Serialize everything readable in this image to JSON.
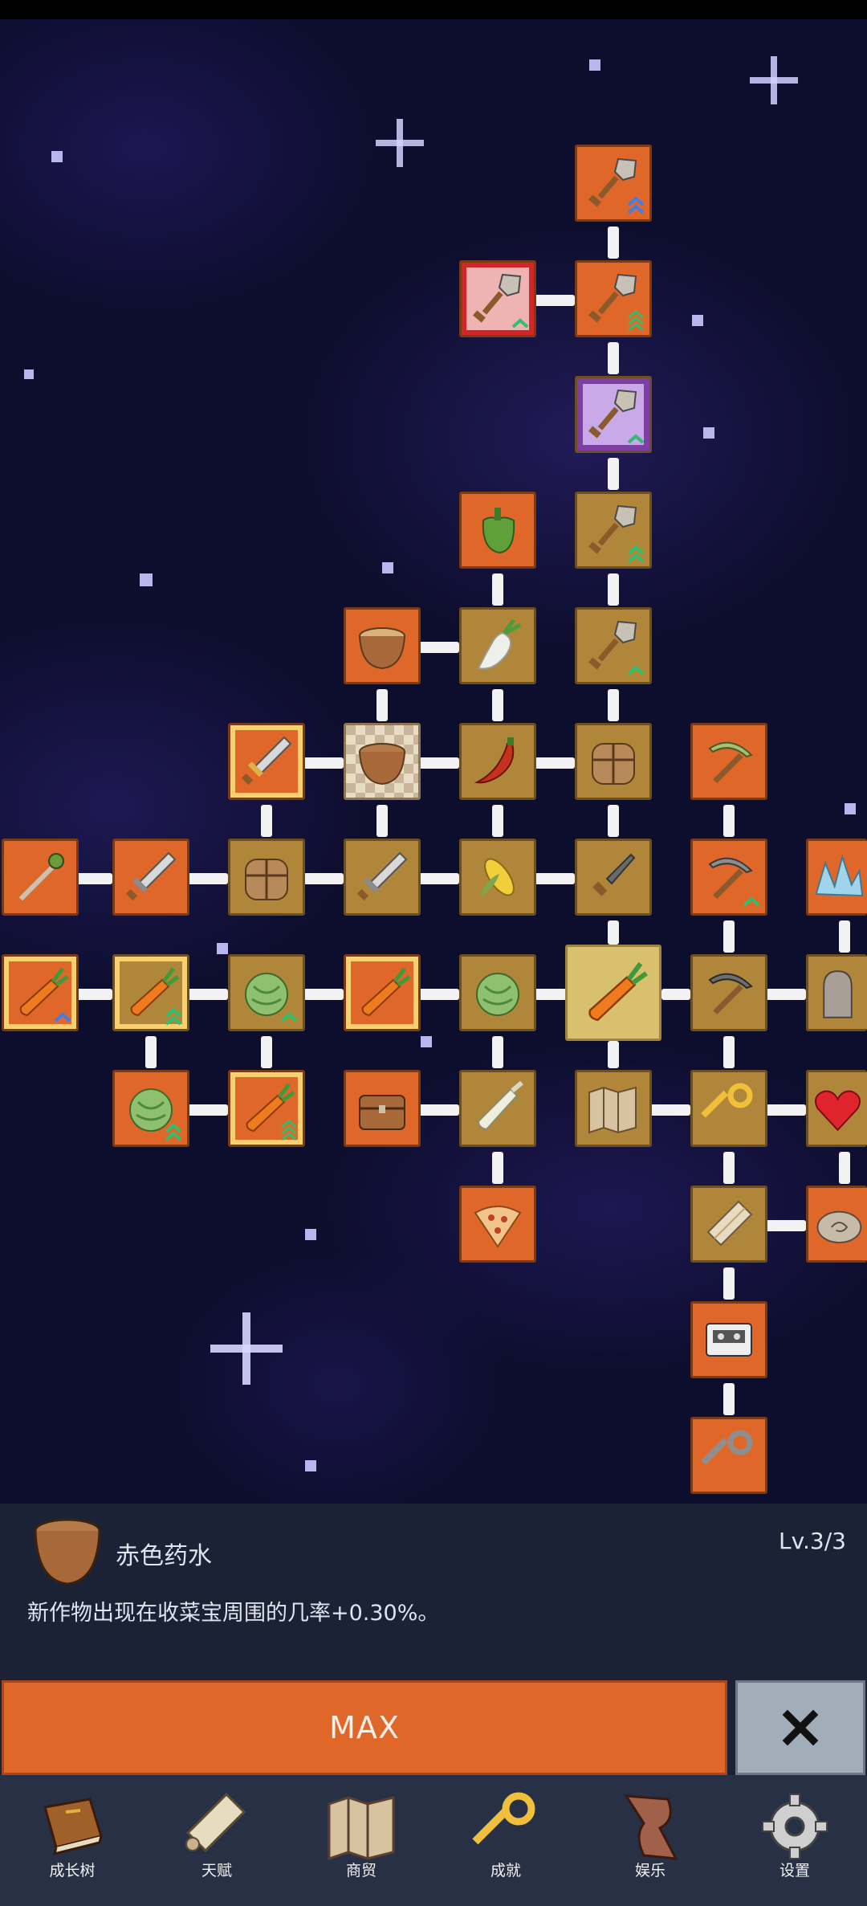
{
  "skill_tree": {
    "nodes": [
      {
        "id": "shovel-a",
        "icon": "shovel-icon",
        "color": "orange"
      },
      {
        "id": "shovel-b",
        "icon": "shovel-icon",
        "color": "orange"
      },
      {
        "id": "shovel-rare",
        "icon": "shovel-icon",
        "color": "pink"
      },
      {
        "id": "shovel-epic",
        "icon": "shovel-icon",
        "color": "purple"
      },
      {
        "id": "pepper",
        "icon": "pepper-icon",
        "color": "orange"
      },
      {
        "id": "shovel-c",
        "icon": "shovel-icon",
        "color": "olive"
      },
      {
        "id": "shovel-d",
        "icon": "shovel-icon",
        "color": "olive"
      },
      {
        "id": "bowl-a",
        "icon": "bowl-icon",
        "color": "orange"
      },
      {
        "id": "radish",
        "icon": "radish-icon",
        "color": "olive"
      },
      {
        "id": "sword-a",
        "icon": "sword-icon",
        "color": "orange"
      },
      {
        "id": "bowl-selected",
        "icon": "bowl-icon",
        "color": "checker"
      },
      {
        "id": "chili",
        "icon": "chili-icon",
        "color": "olive"
      },
      {
        "id": "backpack-a",
        "icon": "backpack-icon",
        "color": "olive"
      },
      {
        "id": "pickaxe-a",
        "icon": "pickaxe-icon",
        "color": "orange"
      },
      {
        "id": "staff",
        "icon": "staff-icon",
        "color": "orange"
      },
      {
        "id": "sword-b",
        "icon": "sword-icon",
        "color": "orange"
      },
      {
        "id": "backpack-b",
        "icon": "backpack-icon",
        "color": "olive"
      },
      {
        "id": "sword-c",
        "icon": "sword-icon",
        "color": "olive"
      },
      {
        "id": "corn",
        "icon": "corn-icon",
        "color": "olive"
      },
      {
        "id": "dagger",
        "icon": "dagger-icon",
        "color": "olive"
      },
      {
        "id": "pickaxe-b",
        "icon": "pickaxe-icon",
        "color": "orange"
      },
      {
        "id": "crystal",
        "icon": "crystal-icon",
        "color": "orange"
      },
      {
        "id": "carrot-a",
        "icon": "carrot-icon",
        "color": "orange"
      },
      {
        "id": "carrot-b",
        "icon": "carrot-icon",
        "color": "olive"
      },
      {
        "id": "cabbage-a",
        "icon": "cabbage-icon",
        "color": "olive"
      },
      {
        "id": "carrot-c",
        "icon": "carrot-icon",
        "color": "orange"
      },
      {
        "id": "cabbage-b",
        "icon": "cabbage-icon",
        "color": "olive"
      },
      {
        "id": "carrot-root",
        "icon": "carrot-icon",
        "color": "selected"
      },
      {
        "id": "pickaxe-c",
        "icon": "pickaxe-icon",
        "color": "olive"
      },
      {
        "id": "statue",
        "icon": "statue-icon",
        "color": "olive"
      },
      {
        "id": "cabbage-c",
        "icon": "cabbage-icon",
        "color": "orange"
      },
      {
        "id": "carrot-d",
        "icon": "carrot-icon",
        "color": "orange"
      },
      {
        "id": "chest",
        "icon": "chest-icon",
        "color": "orange"
      },
      {
        "id": "leek",
        "icon": "leek-icon",
        "color": "olive"
      },
      {
        "id": "map",
        "icon": "map-icon",
        "color": "olive"
      },
      {
        "id": "key-gold",
        "icon": "key-icon",
        "color": "olive"
      },
      {
        "id": "heart",
        "icon": "heart-icon",
        "color": "olive"
      },
      {
        "id": "pizza",
        "icon": "pizza-icon",
        "color": "orange"
      },
      {
        "id": "scroll",
        "icon": "scroll-icon",
        "color": "olive"
      },
      {
        "id": "stone",
        "icon": "stone-icon",
        "color": "orange"
      },
      {
        "id": "cassette",
        "icon": "cassette-icon",
        "color": "orange"
      },
      {
        "id": "key-iron",
        "icon": "key-icon",
        "color": "orange"
      }
    ]
  },
  "detail": {
    "icon": "bowl-icon",
    "name": "赤色药水",
    "level": "Lv.3/3",
    "description": "新作物出现在收菜宝周围的几率+0.30%。",
    "action_label": "MAX",
    "close_icon": "close-icon"
  },
  "nav": {
    "items": [
      {
        "label": "成长树",
        "icon": "book-icon"
      },
      {
        "label": "天赋",
        "icon": "scroll-icon"
      },
      {
        "label": "商贸",
        "icon": "map-icon"
      },
      {
        "label": "成就",
        "icon": "key-icon"
      },
      {
        "label": "娱乐",
        "icon": "flag-icon"
      },
      {
        "label": "设置",
        "icon": "gear-icon"
      }
    ]
  },
  "colors": {
    "orange_node": "#e0672a",
    "olive_node": "#b0873a",
    "selected_node": "#d8c06e",
    "panel_bg": "#1b2235",
    "nav_bg": "#273044",
    "close_button": "#a2adba"
  }
}
